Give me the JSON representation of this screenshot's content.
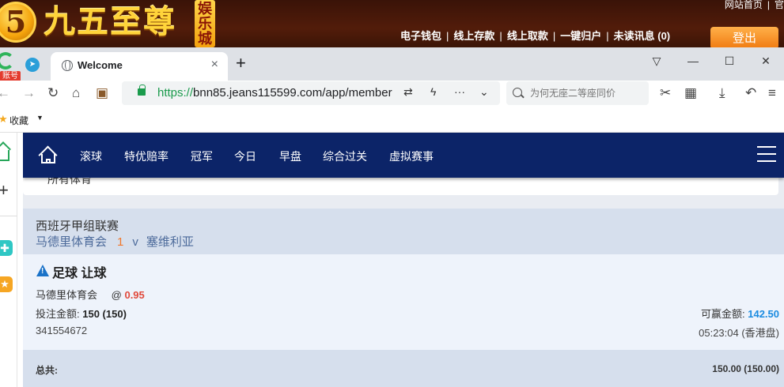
{
  "banner": {
    "logo_badge": "5",
    "logo_text": "九五至尊",
    "logo_sub": "娱乐城",
    "top_links": [
      "网站首页",
      "官"
    ],
    "account_links": [
      "电子钱包",
      "线上存款",
      "线上取款",
      "一键归户",
      "未读讯息 (0)"
    ],
    "separator": "|",
    "login_label": "登出"
  },
  "browser": {
    "badge_account": "账号",
    "tab_title": "Welcome",
    "tab_close": "×",
    "new_tab": "+",
    "window_controls": [
      "▽",
      "—",
      "☐",
      "✕"
    ],
    "url_scheme": "https://",
    "url_rest": "bnn85.jeans115599.com/app/member",
    "search_placeholder": "为何无座二等座同价",
    "bookmark_label": "收藏"
  },
  "nav": {
    "items": [
      "滚球",
      "特优赔率",
      "冠军",
      "今日",
      "早盘",
      "综合过关",
      "虚拟赛事"
    ]
  },
  "sport_select": {
    "label": "所有体育"
  },
  "league": {
    "name": "西班牙甲组联赛",
    "home_team": "马德里体育会",
    "score": "1",
    "vs": "v",
    "away_team": "塞维利亚"
  },
  "bet": {
    "type": "足球 让球",
    "pick": "马德里体育会",
    "at": "@",
    "odds": "0.95",
    "stake_label": "投注金额:",
    "stake_value": "150 (150)",
    "win_label": "可赢金额:",
    "win_value": "142.50",
    "ticket_id": "341554672",
    "time": "05:23:04 (香港盘)"
  },
  "total": {
    "label": "总共:",
    "value": "150.00 (150.00)"
  },
  "colors": {
    "nav_bg": "#0c2468",
    "banner_bg": "#521c0a",
    "odds": "#e14a3c",
    "win_value": "#1a8be0",
    "score": "#f0772b",
    "team_link": "#4d6b9b",
    "league_bg": "#d6dfed"
  }
}
